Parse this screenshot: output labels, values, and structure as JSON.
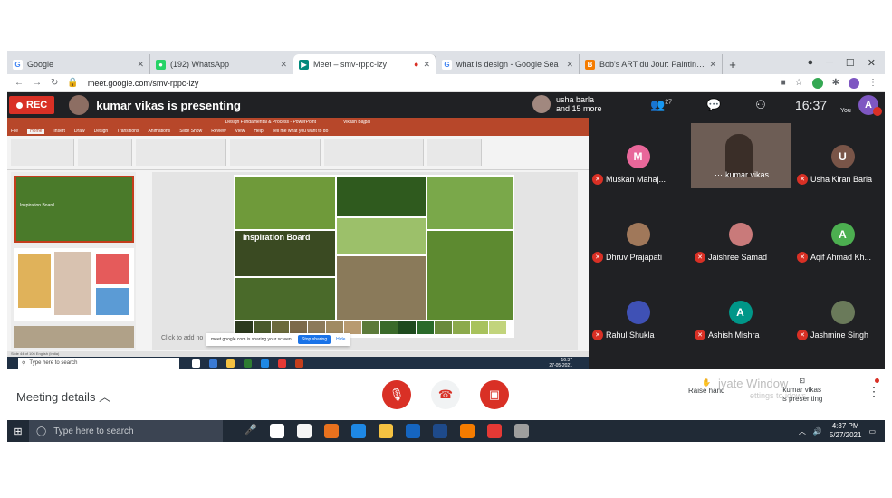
{
  "browser": {
    "tabs": [
      {
        "label": "Google",
        "icon": "google-icon",
        "active": false
      },
      {
        "label": "(192) WhatsApp",
        "icon": "whatsapp-icon",
        "active": false
      },
      {
        "label": "Meet – smv-rppc-izy",
        "icon": "meet-icon",
        "active": true
      },
      {
        "label": "what is design - Google Sea",
        "icon": "google-icon",
        "active": false
      },
      {
        "label": "Bob's ART du Jour: Painting -",
        "icon": "blogger-icon",
        "active": false
      }
    ],
    "new_tab": "+",
    "url": "meet.google.com/smv-rppc-izy"
  },
  "meet": {
    "rec_label": "REC",
    "presenting_text": "kumar vikas is presenting",
    "joined_text_1": "usha barla",
    "joined_text_2": "and 15 more",
    "participants_count": "27",
    "time": "16:37",
    "you_label": "You",
    "you_initial": "A"
  },
  "presentation": {
    "window_title": "Design Fundamental & Process - PowerPoint",
    "user_name": "Vikash Bajpai",
    "menu": [
      "File",
      "Home",
      "Insert",
      "Draw",
      "Design",
      "Transitions",
      "Animations",
      "Slide Show",
      "Review",
      "View",
      "Help",
      "Tell me what you want to do"
    ],
    "thumb1_text": "Inspiration Board",
    "slide_caption": "Inspiration Board",
    "click_note": "Click to add no",
    "share_note": "meet.google.com is sharing your screen.",
    "stop_sharing": "Stop sharing",
    "hide": "Hide",
    "status": "Slide 44 of 106    English (India)",
    "inner_search": "Type here to search",
    "inner_time": "16:37",
    "inner_date": "27-05-2021",
    "swatch_colors": [
      "#2c3a1e",
      "#4a5a2c",
      "#6b6a3c",
      "#7c6a4a",
      "#8c7a5a",
      "#a08a62",
      "#b89a70",
      "#5c7a3a",
      "#3a6a2a",
      "#1e4a1e",
      "#2a6a2a",
      "#6a8a3c",
      "#8caa4c",
      "#a8c25c",
      "#c2d47c"
    ]
  },
  "participants": [
    {
      "name": "Muskan Mahaj...",
      "initial": "M",
      "color": "#e8679a",
      "kind": "initial"
    },
    {
      "name": "kumar vikas",
      "initial": "",
      "color": "#6d5d55",
      "kind": "video"
    },
    {
      "name": "Usha Kiran Barla",
      "initial": "U",
      "color": "#795548",
      "kind": "initial"
    },
    {
      "name": "Dhruv Prajapati",
      "initial": "",
      "color": "#a0785a",
      "kind": "photo"
    },
    {
      "name": "Jaishree Samad",
      "initial": "",
      "color": "#c97a7a",
      "kind": "photo"
    },
    {
      "name": "Aqif Ahmad Kh...",
      "initial": "A",
      "color": "#4caf50",
      "kind": "initial"
    },
    {
      "name": "Rahul Shukla",
      "initial": "",
      "color": "#3f51b5",
      "kind": "photo"
    },
    {
      "name": "Ashish Mishra",
      "initial": "A",
      "color": "#009688",
      "kind": "initial"
    },
    {
      "name": "Jashmine Singh",
      "initial": "",
      "color": "#6a7a5a",
      "kind": "photo"
    }
  ],
  "bottom": {
    "meeting_details": "Meeting details",
    "raise_hand": "Raise hand",
    "watermark_1": "ivate Window",
    "watermark_2": "ettings to    idows.",
    "presenting_1": "kumar vikas",
    "presenting_2": "is presenting"
  },
  "taskbar": {
    "search_placeholder": "Type here to search",
    "time": "4:37 PM",
    "date": "5/27/2021"
  },
  "colors": {
    "meet_red": "#d93025",
    "ppt_red": "#b7472a",
    "meet_dark": "#202124"
  }
}
